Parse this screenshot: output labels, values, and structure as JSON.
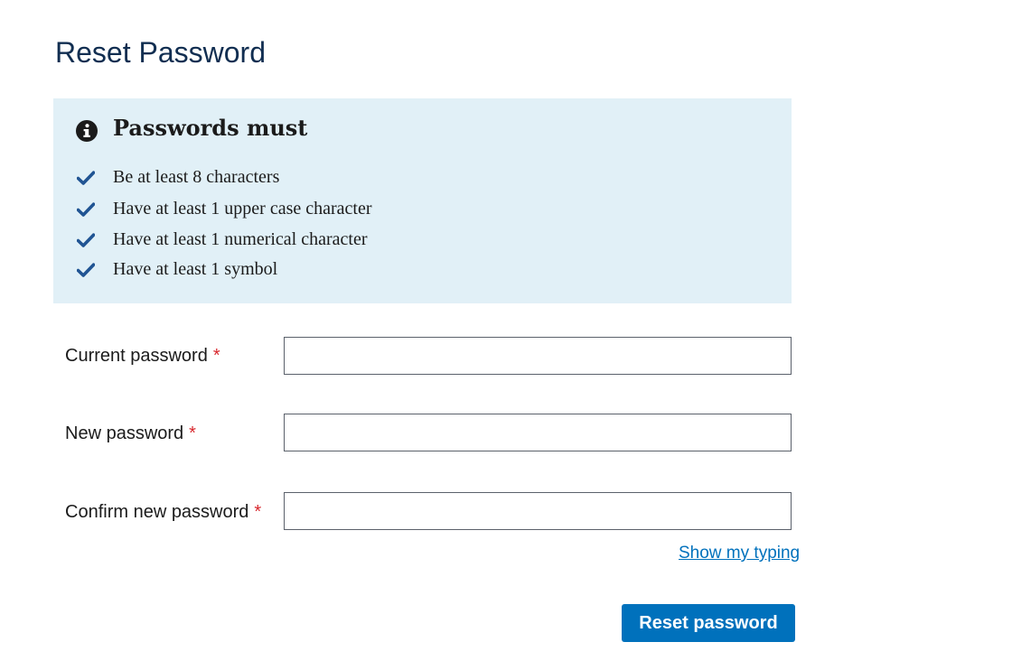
{
  "page": {
    "title": "Reset Password"
  },
  "info_box": {
    "icon": "info-circle-icon",
    "heading": "Passwords must",
    "background_color": "#e1f0f7",
    "requirements": [
      {
        "icon": "checkmark-icon",
        "text": "Be at least 8 characters"
      },
      {
        "icon": "checkmark-icon",
        "text": "Have at least 1 upper case character"
      },
      {
        "icon": "checkmark-icon",
        "text": "Have at least 1 numerical character"
      },
      {
        "icon": "checkmark-icon",
        "text": "Have at least 1 symbol"
      }
    ]
  },
  "form": {
    "required_marker": "*",
    "fields": [
      {
        "label": "Current password",
        "value": "",
        "required": true
      },
      {
        "label": "New password",
        "value": "",
        "required": true
      },
      {
        "label": "Confirm new password",
        "value": "",
        "required": true
      }
    ],
    "show_typing_label": "Show my typing",
    "submit_label": "Reset password"
  },
  "colors": {
    "title": "#112e51",
    "accent": "#0071bc",
    "required": "#d8272d",
    "checkmark": "#205493"
  }
}
